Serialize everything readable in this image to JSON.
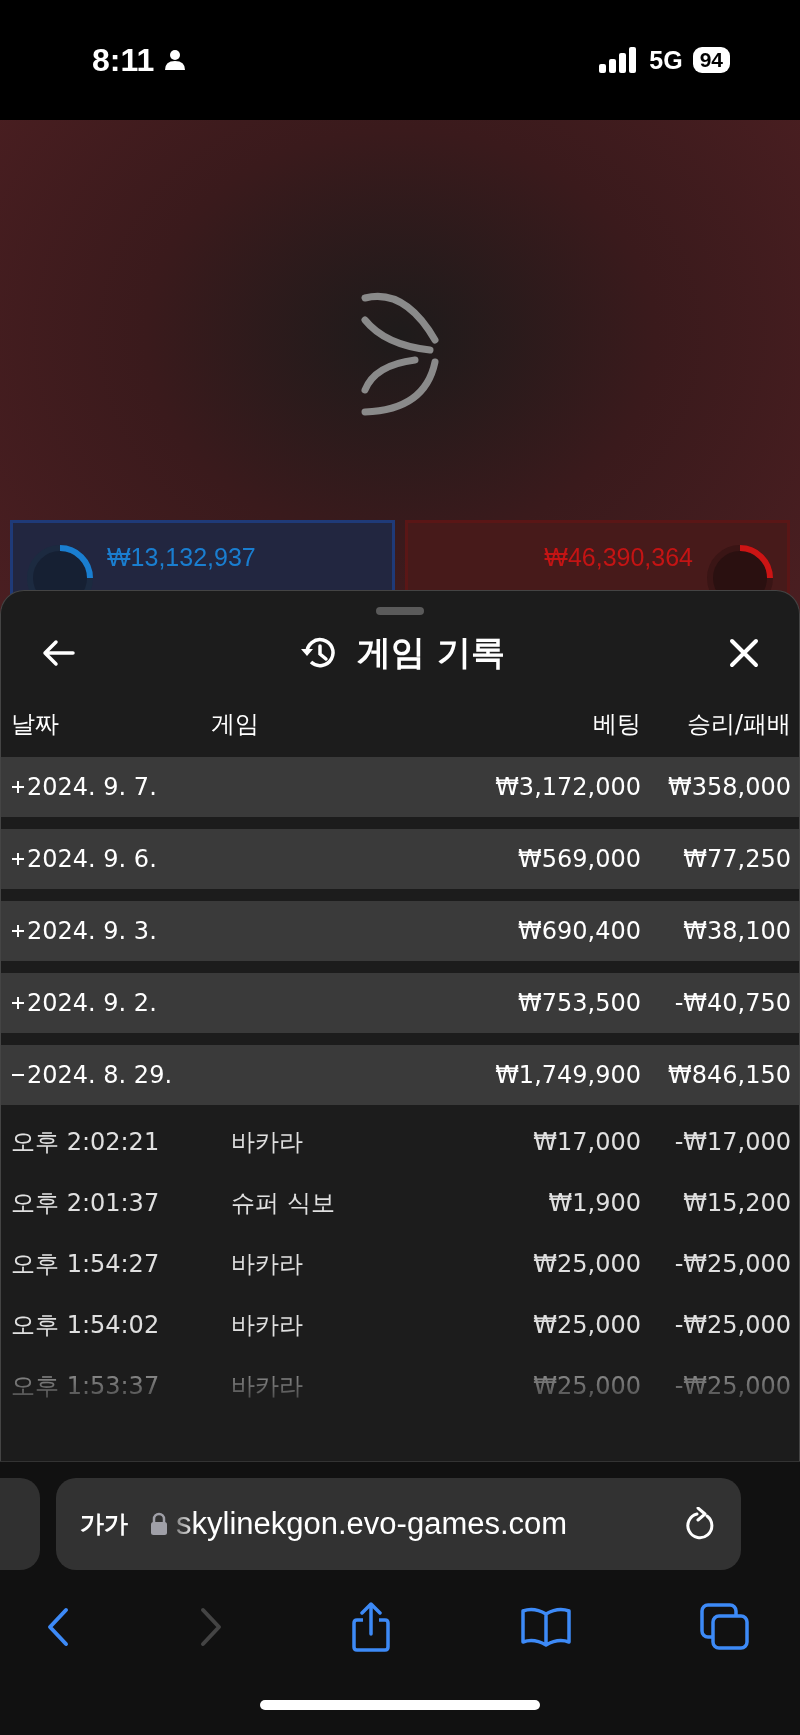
{
  "status_bar": {
    "time": "8:11",
    "network": "5G",
    "battery": "94"
  },
  "game_view": {
    "player": {
      "total": "₩13,132,937"
    },
    "banker": {
      "total": "₩46,390,364"
    }
  },
  "history_sheet": {
    "title": "게임 기록",
    "columns": [
      "날짜",
      "게임",
      "베팅",
      "승리/패배"
    ],
    "days": [
      {
        "date": "2024. 9. 7.",
        "bet": "₩3,172,000",
        "result": "₩358,000",
        "expanded": false
      },
      {
        "date": "2024. 9. 6.",
        "bet": "₩569,000",
        "result": "₩77,250",
        "expanded": false
      },
      {
        "date": "2024. 9. 3.",
        "bet": "₩690,400",
        "result": "₩38,100",
        "expanded": false
      },
      {
        "date": "2024. 9. 2.",
        "bet": "₩753,500",
        "result": "-₩40,750",
        "expanded": false
      },
      {
        "date": "2024. 8. 29.",
        "bet": "₩1,749,900",
        "result": "₩846,150",
        "expanded": true,
        "rounds": [
          {
            "time": "오후 2:02:21",
            "game": "바카라",
            "bet": "₩17,000",
            "result": "-₩17,000"
          },
          {
            "time": "오후 2:01:37",
            "game": "슈퍼 식보",
            "bet": "₩1,900",
            "result": "₩15,200"
          },
          {
            "time": "오후 1:54:27",
            "game": "바카라",
            "bet": "₩25,000",
            "result": "-₩25,000"
          },
          {
            "time": "오후 1:54:02",
            "game": "바카라",
            "bet": "₩25,000",
            "result": "-₩25,000"
          },
          {
            "time": "오후 1:53:37",
            "game": "바카라",
            "bet": "₩25,000",
            "result": "-₩25,000"
          }
        ]
      }
    ]
  },
  "browser": {
    "text_size_button": "가가",
    "url": "skylinekgon.evo-games.com"
  }
}
